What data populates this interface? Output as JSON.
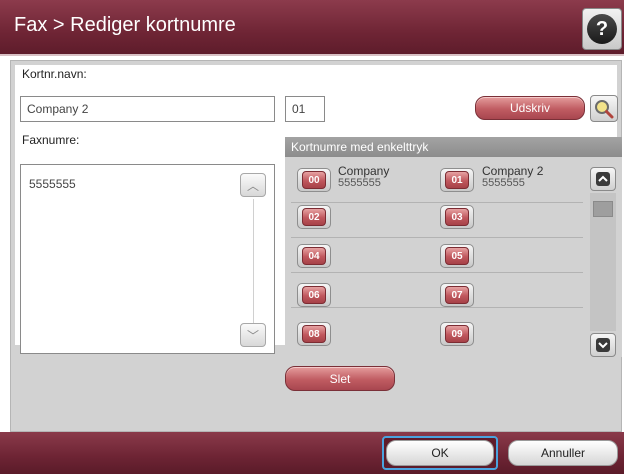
{
  "header": {
    "title": "Fax > Rediger kortnumre",
    "help_glyph": "?"
  },
  "form": {
    "name_label": "Kortnr.navn:",
    "name_value": "Company 2",
    "number_value": "01",
    "fax_label": "Faxnumre:",
    "fax_entries": [
      "5555555"
    ],
    "print_label": "Udskriv",
    "search_icon": "magnifier-icon",
    "delete_label": "Slet"
  },
  "speed_dials": {
    "header": "Kortnumre med enkelttryk",
    "items": [
      {
        "code": "00",
        "name": "Company",
        "number": "5555555"
      },
      {
        "code": "01",
        "name": "Company 2",
        "number": "5555555"
      },
      {
        "code": "02",
        "name": "",
        "number": ""
      },
      {
        "code": "03",
        "name": "",
        "number": ""
      },
      {
        "code": "04",
        "name": "",
        "number": ""
      },
      {
        "code": "05",
        "name": "",
        "number": ""
      },
      {
        "code": "06",
        "name": "",
        "number": ""
      },
      {
        "code": "07",
        "name": "",
        "number": ""
      },
      {
        "code": "08",
        "name": "",
        "number": ""
      },
      {
        "code": "09",
        "name": "",
        "number": ""
      }
    ]
  },
  "footer": {
    "ok_label": "OK",
    "cancel_label": "Annuller"
  },
  "colors": {
    "title_bar": "#6f2535",
    "accent_button": "#c05c62",
    "focus_ring": "#4aa3df"
  }
}
